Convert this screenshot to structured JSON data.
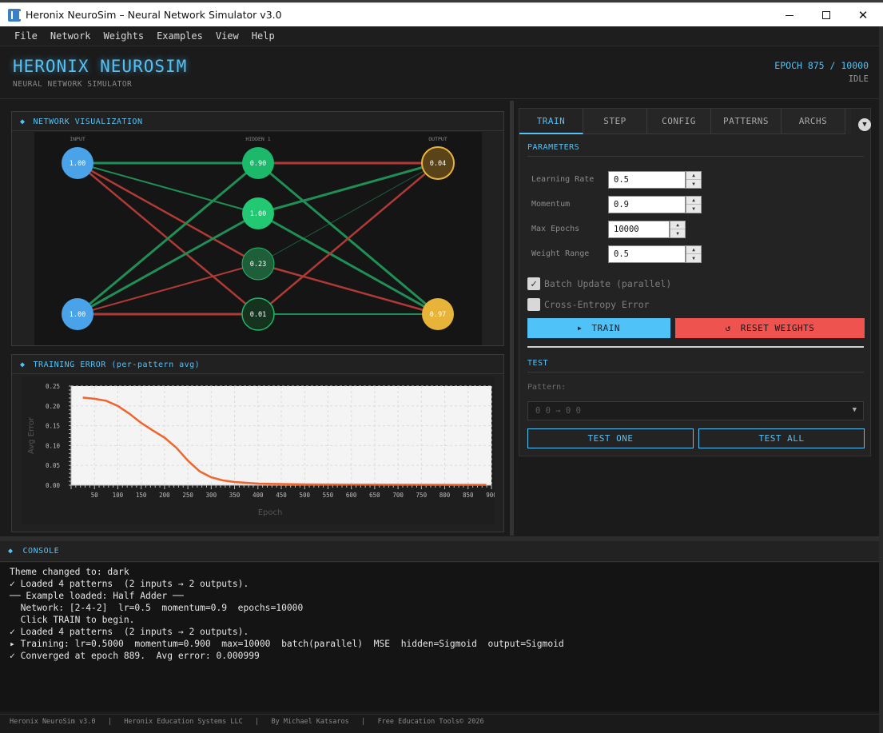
{
  "window": {
    "title": "Heronix NeuroSim – Neural Network Simulator v3.0"
  },
  "menu": [
    "File",
    "Network",
    "Weights",
    "Examples",
    "View",
    "Help"
  ],
  "header": {
    "brand": "HERONIX NEUROSIM",
    "subtitle": "NEURAL NETWORK SIMULATOR",
    "epoch": "EPOCH 875 / 10000",
    "status": "IDLE"
  },
  "network": {
    "title": "NETWORK VISUALIZATION",
    "layers": [
      "INPUT",
      "HIDDEN 1",
      "OUTPUT"
    ],
    "input_values": [
      "1.00",
      "1.00"
    ],
    "hidden_values": [
      "0.90",
      "1.00",
      "0.23",
      "0.01"
    ],
    "output_values": [
      "0.04",
      "0.97"
    ]
  },
  "error_chart": {
    "title": "TRAINING ERROR (per-pattern avg)",
    "chart_data": {
      "type": "line",
      "xlabel": "Epoch",
      "ylabel": "Avg Error",
      "xlim": [
        0,
        900
      ],
      "ylim": [
        0,
        0.25
      ],
      "xticks": [
        50,
        100,
        150,
        200,
        250,
        300,
        350,
        400,
        450,
        500,
        550,
        600,
        650,
        700,
        750,
        800,
        850,
        900
      ],
      "yticks": [
        0.0,
        0.05,
        0.1,
        0.15,
        0.2,
        0.25
      ],
      "ytick_labels": [
        "0.00",
        "0.05",
        "0.10",
        "0.15",
        "0.20",
        "0.25"
      ],
      "grid": true,
      "series": [
        {
          "color": "#f0642d",
          "x": [
            25,
            50,
            75,
            100,
            125,
            150,
            175,
            200,
            225,
            250,
            275,
            300,
            325,
            350,
            375,
            400,
            450,
            500,
            600,
            700,
            800,
            889
          ],
          "y": [
            0.221,
            0.218,
            0.213,
            0.2,
            0.18,
            0.157,
            0.138,
            0.12,
            0.095,
            0.062,
            0.035,
            0.02,
            0.012,
            0.008,
            0.006,
            0.004,
            0.003,
            0.002,
            0.0015,
            0.0012,
            0.001,
            0.001
          ]
        }
      ]
    }
  },
  "tabs": [
    "TRAIN",
    "STEP",
    "CONFIG",
    "PATTERNS",
    "ARCHS"
  ],
  "params": {
    "section": "PARAMETERS",
    "learning_rate_label": "Learning Rate",
    "learning_rate": "0.5",
    "momentum_label": "Momentum",
    "momentum": "0.9",
    "max_epochs_label": "Max Epochs",
    "max_epochs": "10000",
    "weight_range_label": "Weight Range",
    "weight_range": "0.5",
    "batch_label": "Batch Update (parallel)",
    "xent_label": "Cross-Entropy Error"
  },
  "buttons": {
    "train": "TRAIN",
    "reset": "RESET WEIGHTS",
    "test_one": "TEST ONE",
    "test_all": "TEST ALL"
  },
  "test": {
    "section": "TEST",
    "pattern_label": "Pattern:",
    "pattern_value": "0 0  → 0 0"
  },
  "console": {
    "title": "CONSOLE",
    "lines": [
      "Theme changed to: dark",
      "✓ Loaded 4 patterns  (2 inputs → 2 outputs).",
      "── Example loaded: Half Adder ──",
      "  Network: [2-4-2]  lr=0.5  momentum=0.9  epochs=10000",
      "  Click TRAIN to begin.",
      "✓ Loaded 4 patterns  (2 inputs → 2 outputs).",
      "▸ Training: lr=0.5000  momentum=0.900  max=10000  batch(parallel)  MSE  hidden=Sigmoid  output=Sigmoid",
      "✓ Converged at epoch 889.  Avg error: 0.000999"
    ]
  },
  "footer": "Heronix NeuroSim v3.0   |   Heronix Education Systems LLC   |   By Michael Katsaros   |   Free Education Tools© 2026",
  "colors": {
    "accent": "#55c1f5",
    "train_button": "#4fc3f7",
    "reset_button": "#ef5350",
    "input_node": "#4aa3e8",
    "hidden_node": "#1db96a",
    "output_node": "#e8b339",
    "positive_weight": "#1f8f55",
    "negative_weight": "#b03a36"
  }
}
